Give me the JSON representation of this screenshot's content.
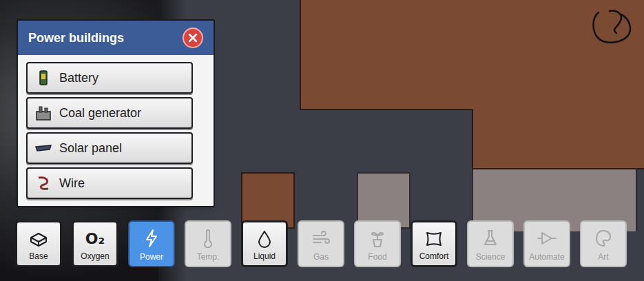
{
  "build_menu": {
    "title": "Power buildings",
    "items": [
      {
        "label": "Battery"
      },
      {
        "label": "Coal generator"
      },
      {
        "label": "Solar panel"
      },
      {
        "label": "Wire"
      }
    ]
  },
  "categories": [
    {
      "label": "Base",
      "selected": false,
      "disabled": false
    },
    {
      "label": "Oxygen",
      "selected": false,
      "disabled": false,
      "glyph": "O₂"
    },
    {
      "label": "Power",
      "selected": true,
      "disabled": false
    },
    {
      "label": "Temp.",
      "selected": false,
      "disabled": true
    },
    {
      "label": "Liquid",
      "selected": false,
      "disabled": false
    },
    {
      "label": "Gas",
      "selected": false,
      "disabled": true
    },
    {
      "label": "Food",
      "selected": false,
      "disabled": true
    },
    {
      "label": "Comfort",
      "selected": false,
      "disabled": false
    },
    {
      "label": "Science",
      "selected": false,
      "disabled": true
    },
    {
      "label": "Automate",
      "selected": false,
      "disabled": true
    },
    {
      "label": "Art",
      "selected": false,
      "disabled": true
    }
  ]
}
